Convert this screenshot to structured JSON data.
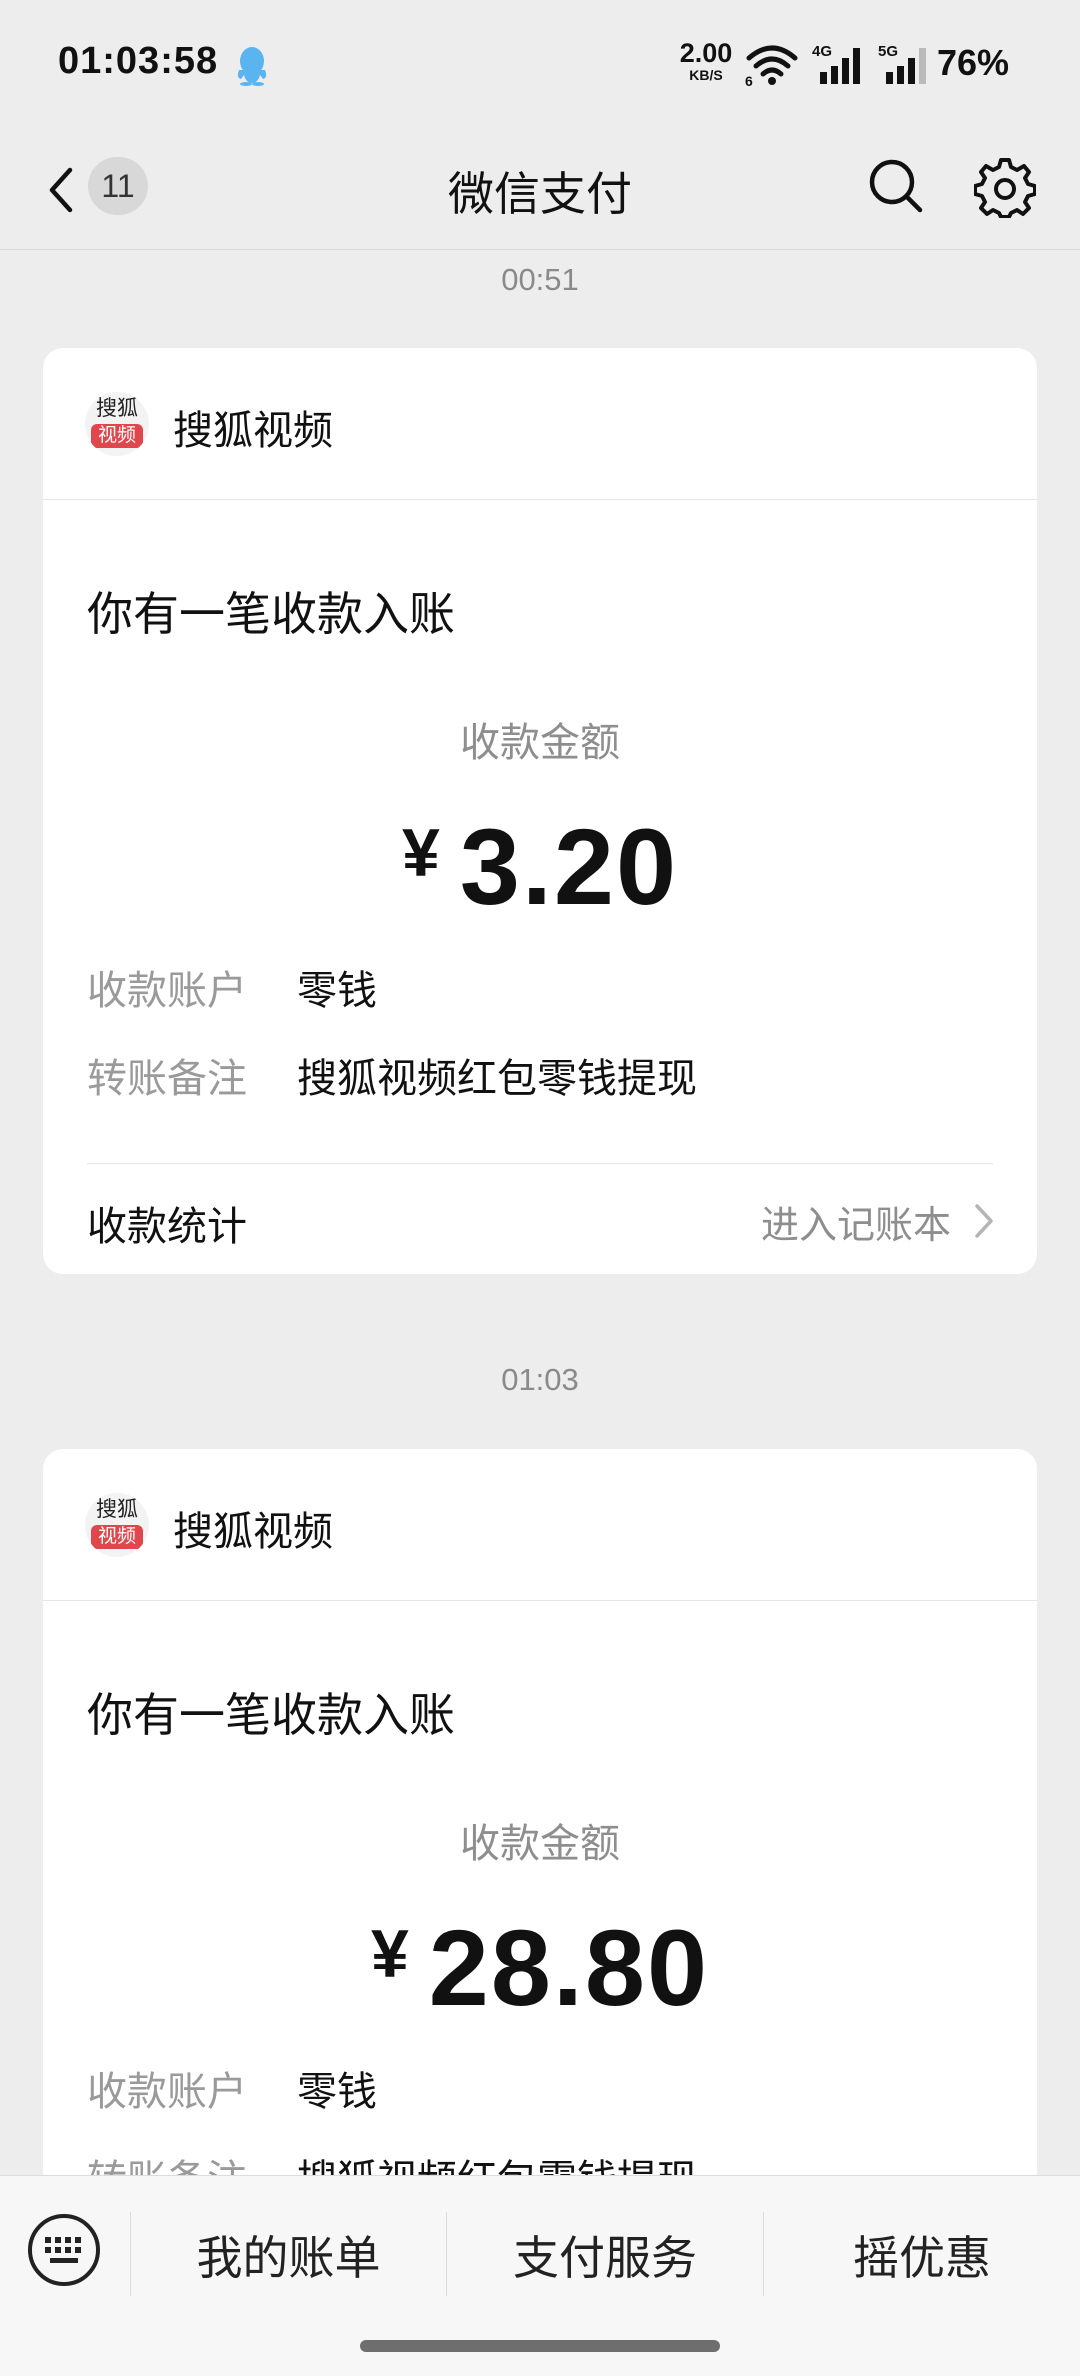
{
  "status_bar": {
    "time": "01:03:58",
    "net_speed": "2.00",
    "net_speed_unit": "KB/S",
    "signal1_label": "4G",
    "signal2_label": "5G",
    "battery": "76%"
  },
  "nav": {
    "unread_count": "11",
    "title": "微信支付"
  },
  "messages": [
    {
      "time": "00:51",
      "app_name": "搜狐视频",
      "logo_top": "搜狐",
      "logo_bottom": "视频",
      "heading": "你有一笔收款入账",
      "amount_label": "收款金额",
      "currency": "¥",
      "amount": "3.20",
      "account_label": "收款账户",
      "account_value": "零钱",
      "note_label": "转账备注",
      "note_value": "搜狐视频红包零钱提现",
      "footer_left": "收款统计",
      "footer_right": "进入记账本"
    },
    {
      "time": "01:03",
      "app_name": "搜狐视频",
      "logo_top": "搜狐",
      "logo_bottom": "视频",
      "heading": "你有一笔收款入账",
      "amount_label": "收款金额",
      "currency": "¥",
      "amount": "28.80",
      "account_label": "收款账户",
      "account_value": "零钱",
      "note_label": "转账备注",
      "note_value": "搜狐视频红包零钱提现"
    }
  ],
  "bottom_tabs": [
    "我的账单",
    "支付服务",
    "摇优惠"
  ]
}
